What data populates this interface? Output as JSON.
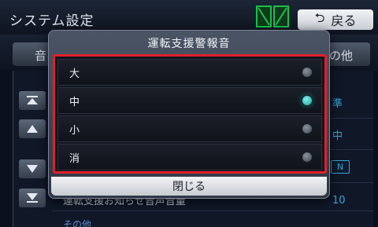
{
  "header": {
    "title": "システム設定",
    "back_label": "戻る"
  },
  "tabs": {
    "left_partial": "音",
    "right_partial": "の他"
  },
  "background_rows": {
    "value_1": "準",
    "value_2": "中",
    "toggle": "N",
    "row_label": "運転支援お知らせ音声音量",
    "value_3": "10",
    "section": "その他"
  },
  "dialog": {
    "title": "運転支援警報音",
    "options": [
      {
        "label": "大",
        "selected": false
      },
      {
        "label": "中",
        "selected": true
      },
      {
        "label": "小",
        "selected": false
      },
      {
        "label": "消",
        "selected": false
      }
    ],
    "close_label": "閉じる"
  },
  "colors": {
    "highlight_border": "#e0202a",
    "selected_radio": "#2fd3cf",
    "accent_text": "#3aa6d8"
  }
}
